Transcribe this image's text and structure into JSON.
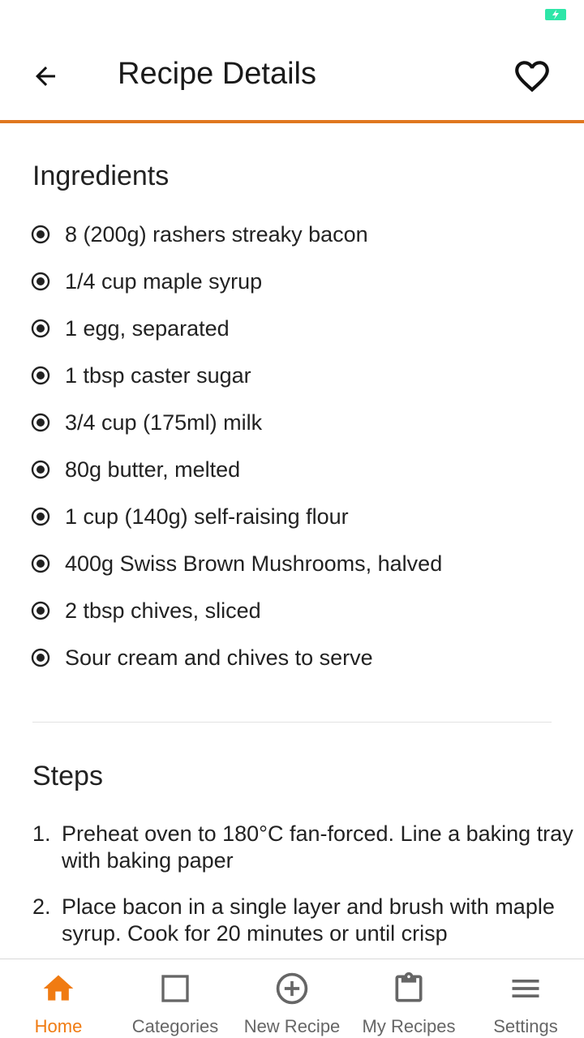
{
  "header": {
    "title": "Recipe Details",
    "back_icon": "arrow-left-icon",
    "favorite_icon": "heart-outline-icon"
  },
  "ingredients": {
    "title": "Ingredients",
    "items": [
      "8 (200g) rashers streaky bacon",
      "1/4 cup maple syrup",
      "1 egg, separated",
      "1 tbsp caster sugar",
      "3/4 cup (175ml) milk",
      "80g butter, melted",
      "1 cup (140g) self-raising flour",
      "400g Swiss Brown Mushrooms, halved",
      "2 tbsp chives, sliced",
      "Sour cream and chives to serve"
    ]
  },
  "steps": {
    "title": "Steps",
    "items": [
      {
        "number": "1.",
        "text": "Preheat oven to 180°C fan-forced. Line a baking tray with baking paper"
      },
      {
        "number": "2.",
        "text": "Place bacon in a single layer and brush with maple syrup. Cook for 20 minutes or until crisp"
      }
    ]
  },
  "bottom_nav": {
    "items": [
      {
        "label": "Home",
        "icon": "home-icon",
        "active": true
      },
      {
        "label": "Categories",
        "icon": "square-icon",
        "active": false
      },
      {
        "label": "New Recipe",
        "icon": "add-circle-icon",
        "active": false
      },
      {
        "label": "My Recipes",
        "icon": "clipboard-icon",
        "active": false
      },
      {
        "label": "Settings",
        "icon": "menu-icon",
        "active": false
      }
    ]
  },
  "colors": {
    "accent": "#f07b12",
    "header_line": "#e0771f",
    "battery": "#2ee6a8",
    "inactive_nav": "#666666"
  }
}
